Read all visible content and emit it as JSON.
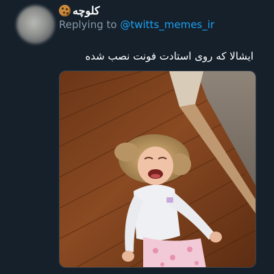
{
  "tweet": {
    "display_name": "کلوچه",
    "display_name_emoji": "cookie-emoji",
    "reply_prefix": "Replying to",
    "reply_handle": "@twitts_memes_ir",
    "text": "ایشالا که روی استادت فونت نصب شده",
    "media_alt": "crying-toddler-on-floor-photo"
  },
  "colors": {
    "background": "#15202b",
    "link": "#1da1f2",
    "secondary_text": "#8899a6",
    "primary_text": "#ffffff"
  }
}
